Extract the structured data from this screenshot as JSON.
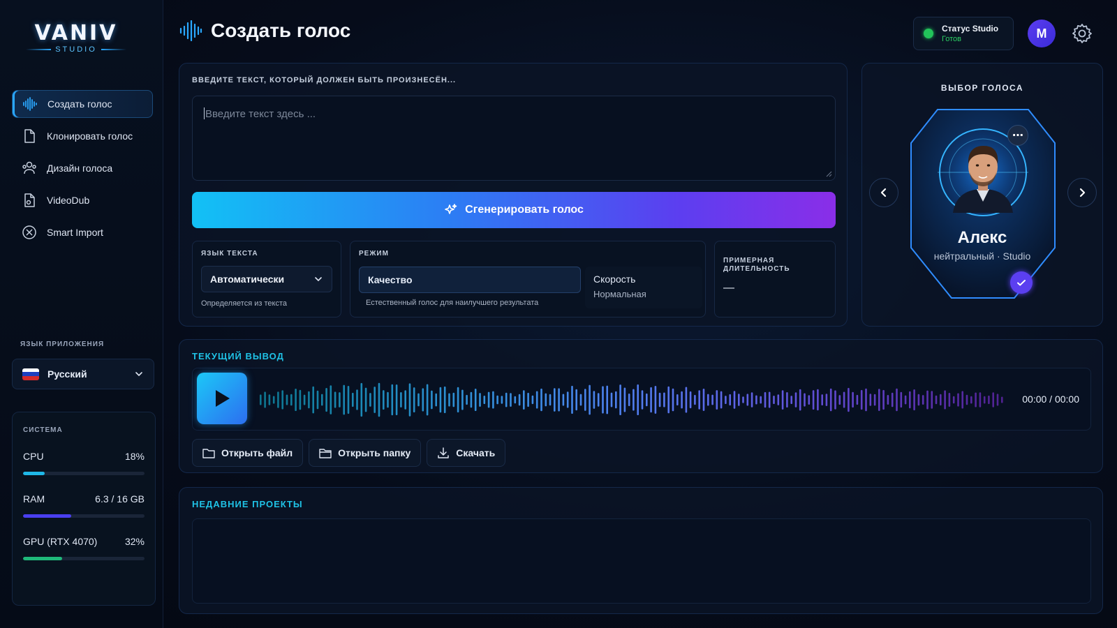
{
  "logo": {
    "main": "VANIV",
    "sub": "STUDIO"
  },
  "sidebar": {
    "items": [
      {
        "label": "Создать голос",
        "icon": "waveform-icon"
      },
      {
        "label": "Клонировать голос",
        "icon": "document-icon"
      },
      {
        "label": "Дизайн голоса",
        "icon": "users-icon"
      },
      {
        "label": "VideoDub",
        "icon": "file-audio-icon"
      },
      {
        "label": "Smart Import",
        "icon": "circle-x-icon"
      }
    ],
    "app_language_label": "ЯЗЫК ПРИЛОЖЕНИЯ",
    "app_language_value": "Русский"
  },
  "system": {
    "title": "СИСТЕМА",
    "metrics": [
      {
        "name": "CPU",
        "value": "18%",
        "fraction": 0.18,
        "color": "#1fb8e8"
      },
      {
        "name": "RAM",
        "value": "6.3 / 16 GB",
        "fraction": 0.394,
        "color": "#4a3ff0"
      },
      {
        "name": "GPU (RTX 4070)",
        "value": "32%",
        "fraction": 0.32,
        "color": "#1fb87a"
      }
    ]
  },
  "header": {
    "title": "Создать голос",
    "status_title": "Статус Studio",
    "status_value": "Готов",
    "avatar_initial": "M"
  },
  "input": {
    "label": "ВВЕДИТЕ ТЕКСТ, КОТОРЫЙ ДОЛЖЕН БЫТЬ ПРОИЗНЕСЁН...",
    "placeholder": "Введите текст здесь ...",
    "generate_label": "Сгенерировать голос"
  },
  "options": {
    "language_label": "ЯЗЫК ТЕКСТА",
    "language_value": "Автоматически",
    "language_hint": "Определяется из текста",
    "mode_label": "РЕЖИМ",
    "mode_quality": "Качество",
    "mode_hint": "Естественный голос для наилучшего результата",
    "mode_speed": "Скорость",
    "mode_speed_sub": "Нормальная",
    "duration_label": "ПРИМЕРНАЯ ДЛИТЕЛЬНОСТЬ",
    "duration_value": "—"
  },
  "voice": {
    "title": "ВЫБОР ГОЛОСА",
    "name": "Алекс",
    "subtitle": "нейтральный · Studio"
  },
  "output": {
    "label": "ТЕКУЩИЙ ВЫВОД",
    "time": "00:00 / 00:00",
    "open_file": "Открыть файл",
    "open_folder": "Открыть папку",
    "download": "Скачать"
  },
  "recent": {
    "label": "НЕДАВНИЕ ПРОЕКТЫ"
  },
  "colors": {
    "accent_cyan": "#1fc2e6",
    "accent_purple": "#5b3ff0",
    "status_green": "#22c35a"
  }
}
